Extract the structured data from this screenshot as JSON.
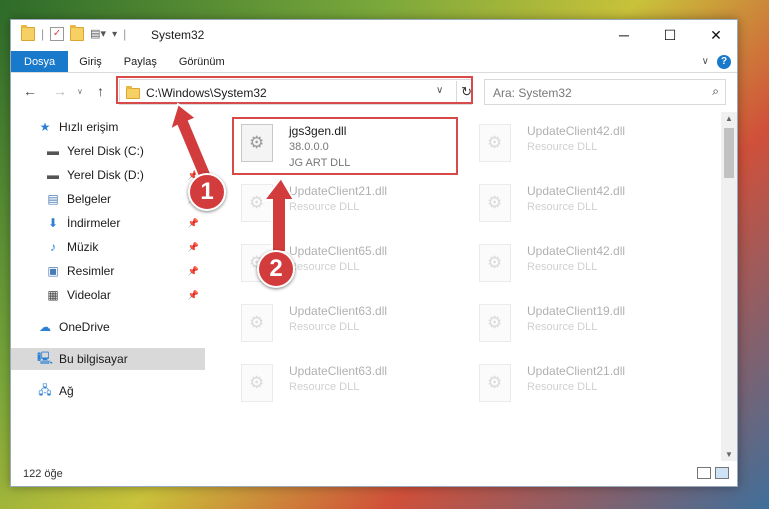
{
  "window": {
    "title": "System32"
  },
  "ribbon": {
    "tabs": [
      "Dosya",
      "Giriş",
      "Paylaş",
      "Görünüm"
    ]
  },
  "address": {
    "path": "C:\\Windows\\System32",
    "search_placeholder": "Ara: System32"
  },
  "nav": {
    "items": [
      {
        "label": "Hızlı erişim",
        "icon": "star-icon",
        "pinned": false
      },
      {
        "label": "Yerel Disk (C:)",
        "icon": "drive-icon",
        "pinned": true
      },
      {
        "label": "Yerel Disk (D:)",
        "icon": "drive-icon",
        "pinned": true
      },
      {
        "label": "Belgeler",
        "icon": "document-icon",
        "pinned": true
      },
      {
        "label": "İndirmeler",
        "icon": "download-icon",
        "pinned": true
      },
      {
        "label": "Müzik",
        "icon": "music-icon",
        "pinned": true
      },
      {
        "label": "Resimler",
        "icon": "pictures-icon",
        "pinned": true
      },
      {
        "label": "Videolar",
        "icon": "video-icon",
        "pinned": true
      },
      {
        "label": "OneDrive",
        "icon": "cloud-icon",
        "pinned": false
      },
      {
        "label": "Bu bilgisayar",
        "icon": "computer-icon",
        "pinned": false,
        "selected": true
      },
      {
        "label": "Ağ",
        "icon": "network-icon",
        "pinned": false
      }
    ]
  },
  "files": [
    {
      "name": "jgs3gen.dll",
      "sub": "38.0.0.0",
      "type": "JG ART DLL",
      "highlighted": true
    },
    {
      "name": "UpdateClient42.dll",
      "sub": "Resource DLL"
    },
    {
      "name": "UpdateClient21.dll",
      "sub": "Resource DLL"
    },
    {
      "name": "UpdateClient42.dll",
      "sub": "Resource DLL"
    },
    {
      "name": "UpdateClient65.dll",
      "sub": "Resource DLL"
    },
    {
      "name": "UpdateClient42.dll",
      "sub": "Resource DLL"
    },
    {
      "name": "UpdateClient63.dll",
      "sub": "Resource DLL"
    },
    {
      "name": "UpdateClient19.dll",
      "sub": "Resource DLL"
    },
    {
      "name": "UpdateClient63.dll",
      "sub": "Resource DLL"
    },
    {
      "name": "UpdateClient21.dll",
      "sub": "Resource DLL"
    }
  ],
  "status": {
    "count": "122 öğe"
  },
  "markers": [
    "1",
    "2"
  ],
  "colors": {
    "accent": "#1979ca",
    "highlight": "#d84a4a"
  }
}
